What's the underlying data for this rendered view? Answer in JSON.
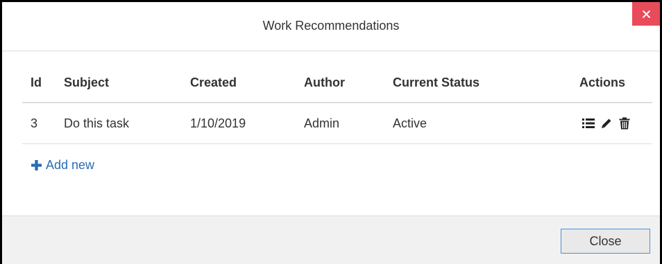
{
  "dialog": {
    "title": "Work Recommendations",
    "close_icon": "close-x-icon"
  },
  "table": {
    "columns": [
      "Id",
      "Subject",
      "Created",
      "Author",
      "Current Status",
      "Actions"
    ],
    "rows": [
      {
        "id": "3",
        "subject": "Do this task",
        "created": "1/10/2019",
        "author": "Admin",
        "status": "Active",
        "actions": [
          "list-icon",
          "pencil-icon",
          "trash-icon"
        ]
      }
    ]
  },
  "add_new": {
    "label": "Add new",
    "icon": "plus-icon"
  },
  "footer": {
    "close_label": "Close"
  },
  "colors": {
    "close_x_bg": "#e84c5a",
    "link": "#2a6cb5",
    "footer_bg": "#f1f1f1",
    "button_border": "#4a90d9"
  }
}
